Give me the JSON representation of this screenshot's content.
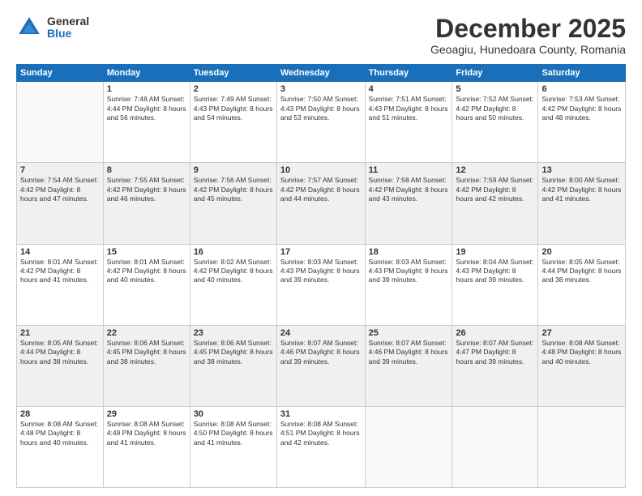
{
  "logo": {
    "general": "General",
    "blue": "Blue"
  },
  "title": "December 2025",
  "subtitle": "Geoagiu, Hunedoara County, Romania",
  "headers": [
    "Sunday",
    "Monday",
    "Tuesday",
    "Wednesday",
    "Thursday",
    "Friday",
    "Saturday"
  ],
  "weeks": [
    [
      {
        "day": "",
        "info": ""
      },
      {
        "day": "1",
        "info": "Sunrise: 7:48 AM\nSunset: 4:44 PM\nDaylight: 8 hours\nand 56 minutes."
      },
      {
        "day": "2",
        "info": "Sunrise: 7:49 AM\nSunset: 4:43 PM\nDaylight: 8 hours\nand 54 minutes."
      },
      {
        "day": "3",
        "info": "Sunrise: 7:50 AM\nSunset: 4:43 PM\nDaylight: 8 hours\nand 53 minutes."
      },
      {
        "day": "4",
        "info": "Sunrise: 7:51 AM\nSunset: 4:43 PM\nDaylight: 8 hours\nand 51 minutes."
      },
      {
        "day": "5",
        "info": "Sunrise: 7:52 AM\nSunset: 4:42 PM\nDaylight: 8 hours\nand 50 minutes."
      },
      {
        "day": "6",
        "info": "Sunrise: 7:53 AM\nSunset: 4:42 PM\nDaylight: 8 hours\nand 48 minutes."
      }
    ],
    [
      {
        "day": "7",
        "info": "Sunrise: 7:54 AM\nSunset: 4:42 PM\nDaylight: 8 hours\nand 47 minutes."
      },
      {
        "day": "8",
        "info": "Sunrise: 7:55 AM\nSunset: 4:42 PM\nDaylight: 8 hours\nand 46 minutes."
      },
      {
        "day": "9",
        "info": "Sunrise: 7:56 AM\nSunset: 4:42 PM\nDaylight: 8 hours\nand 45 minutes."
      },
      {
        "day": "10",
        "info": "Sunrise: 7:57 AM\nSunset: 4:42 PM\nDaylight: 8 hours\nand 44 minutes."
      },
      {
        "day": "11",
        "info": "Sunrise: 7:58 AM\nSunset: 4:42 PM\nDaylight: 8 hours\nand 43 minutes."
      },
      {
        "day": "12",
        "info": "Sunrise: 7:59 AM\nSunset: 4:42 PM\nDaylight: 8 hours\nand 42 minutes."
      },
      {
        "day": "13",
        "info": "Sunrise: 8:00 AM\nSunset: 4:42 PM\nDaylight: 8 hours\nand 41 minutes."
      }
    ],
    [
      {
        "day": "14",
        "info": "Sunrise: 8:01 AM\nSunset: 4:42 PM\nDaylight: 8 hours\nand 41 minutes."
      },
      {
        "day": "15",
        "info": "Sunrise: 8:01 AM\nSunset: 4:42 PM\nDaylight: 8 hours\nand 40 minutes."
      },
      {
        "day": "16",
        "info": "Sunrise: 8:02 AM\nSunset: 4:42 PM\nDaylight: 8 hours\nand 40 minutes."
      },
      {
        "day": "17",
        "info": "Sunrise: 8:03 AM\nSunset: 4:43 PM\nDaylight: 8 hours\nand 39 minutes."
      },
      {
        "day": "18",
        "info": "Sunrise: 8:03 AM\nSunset: 4:43 PM\nDaylight: 8 hours\nand 39 minutes."
      },
      {
        "day": "19",
        "info": "Sunrise: 8:04 AM\nSunset: 4:43 PM\nDaylight: 8 hours\nand 39 minutes."
      },
      {
        "day": "20",
        "info": "Sunrise: 8:05 AM\nSunset: 4:44 PM\nDaylight: 8 hours\nand 38 minutes."
      }
    ],
    [
      {
        "day": "21",
        "info": "Sunrise: 8:05 AM\nSunset: 4:44 PM\nDaylight: 8 hours\nand 38 minutes."
      },
      {
        "day": "22",
        "info": "Sunrise: 8:06 AM\nSunset: 4:45 PM\nDaylight: 8 hours\nand 38 minutes."
      },
      {
        "day": "23",
        "info": "Sunrise: 8:06 AM\nSunset: 4:45 PM\nDaylight: 8 hours\nand 38 minutes."
      },
      {
        "day": "24",
        "info": "Sunrise: 8:07 AM\nSunset: 4:46 PM\nDaylight: 8 hours\nand 39 minutes."
      },
      {
        "day": "25",
        "info": "Sunrise: 8:07 AM\nSunset: 4:46 PM\nDaylight: 8 hours\nand 39 minutes."
      },
      {
        "day": "26",
        "info": "Sunrise: 8:07 AM\nSunset: 4:47 PM\nDaylight: 8 hours\nand 39 minutes."
      },
      {
        "day": "27",
        "info": "Sunrise: 8:08 AM\nSunset: 4:48 PM\nDaylight: 8 hours\nand 40 minutes."
      }
    ],
    [
      {
        "day": "28",
        "info": "Sunrise: 8:08 AM\nSunset: 4:48 PM\nDaylight: 8 hours\nand 40 minutes."
      },
      {
        "day": "29",
        "info": "Sunrise: 8:08 AM\nSunset: 4:49 PM\nDaylight: 8 hours\nand 41 minutes."
      },
      {
        "day": "30",
        "info": "Sunrise: 8:08 AM\nSunset: 4:50 PM\nDaylight: 8 hours\nand 41 minutes."
      },
      {
        "day": "31",
        "info": "Sunrise: 8:08 AM\nSunset: 4:51 PM\nDaylight: 8 hours\nand 42 minutes."
      },
      {
        "day": "",
        "info": ""
      },
      {
        "day": "",
        "info": ""
      },
      {
        "day": "",
        "info": ""
      }
    ]
  ]
}
